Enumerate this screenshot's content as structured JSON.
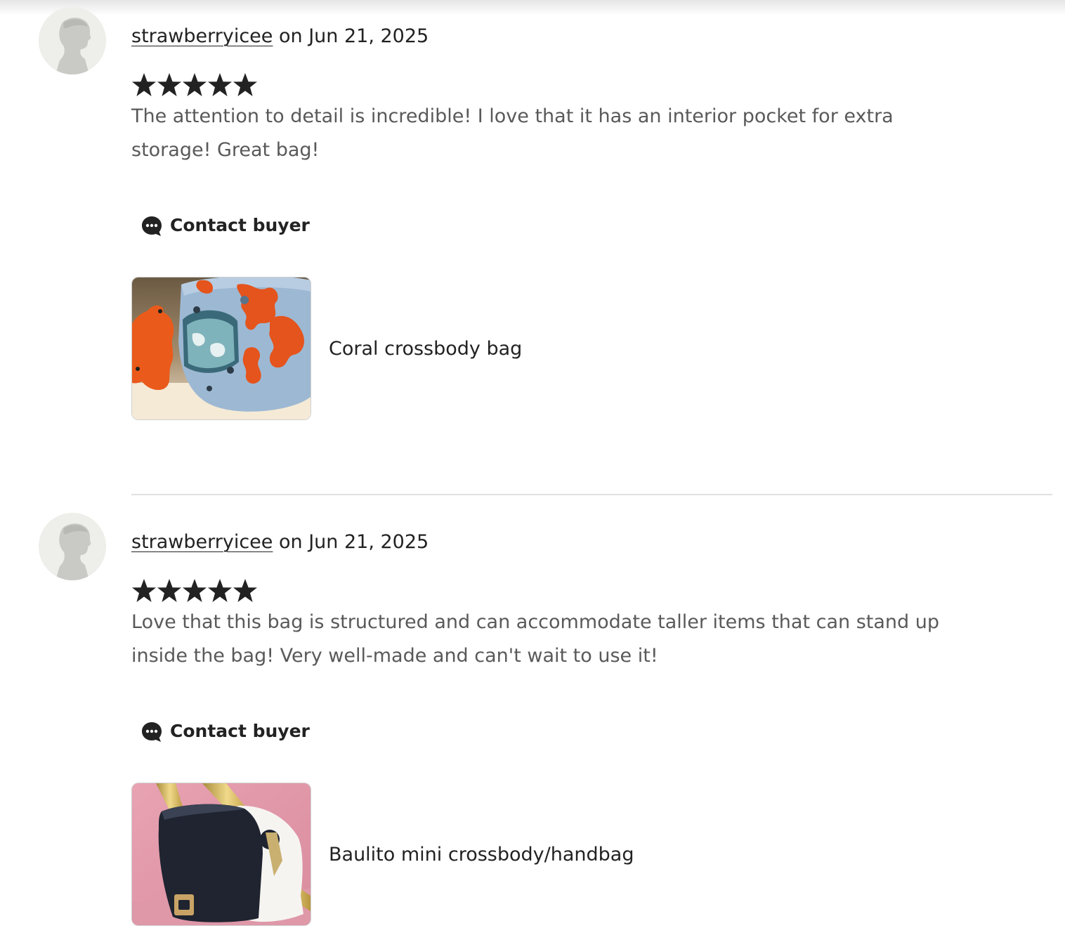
{
  "colors": {
    "text_primary": "#222222",
    "text_secondary": "#595959",
    "star": "#222222",
    "divider": "#e1e1e1"
  },
  "reviews": [
    {
      "username": "strawberryicee",
      "date_text": " on Jun 21, 2025",
      "rating": 5,
      "text": "The attention to detail is incredible! I love that it has an interior pocket for extra storage! Great bag!",
      "contact_label": "Contact buyer",
      "product_title": "Coral crossbody bag",
      "product_image_icon": "coral-bag-photo"
    },
    {
      "username": "strawberryicee",
      "date_text": " on Jun 21, 2025",
      "rating": 5,
      "text": "Love that this bag is structured and can accommodate taller items that can stand up inside the bag! Very well-made and can't wait to use it!",
      "contact_label": "Contact buyer",
      "product_title": "Baulito mini crossbody/handbag",
      "product_image_icon": "baulito-bag-photo"
    }
  ]
}
